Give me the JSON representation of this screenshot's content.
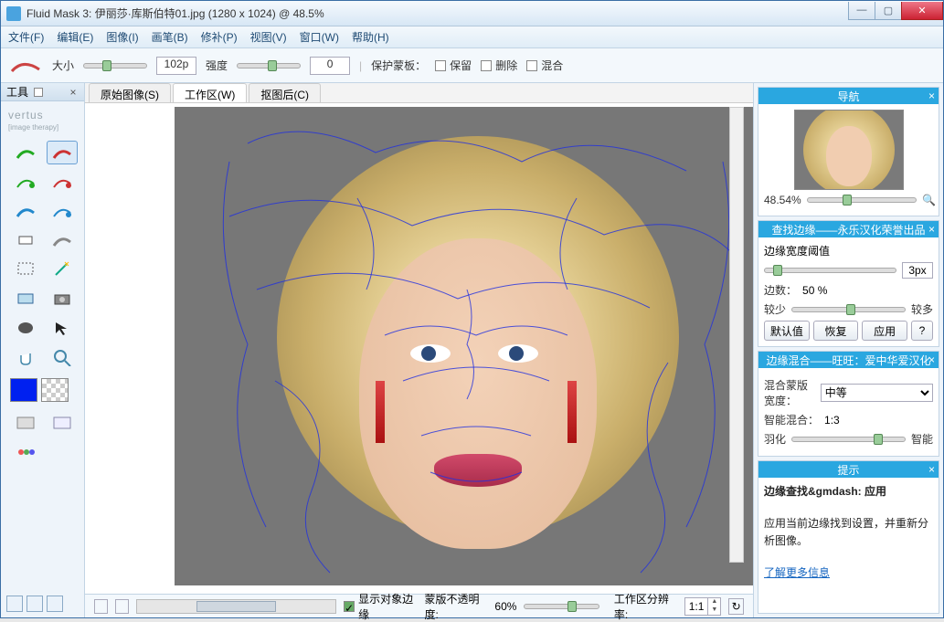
{
  "title": "Fluid Mask 3: 伊丽莎·库斯伯特01.jpg (1280 x 1024) @ 48.5%",
  "menu": [
    "文件(F)",
    "编辑(E)",
    "图像(I)",
    "画笔(B)",
    "修补(P)",
    "视图(V)",
    "窗口(W)",
    "帮助(H)"
  ],
  "opt": {
    "size_label": "大小",
    "size_value": "102p",
    "strength_label": "强度",
    "strength_value": "0",
    "protect_label": "保护蒙板：",
    "chk_keep": "保留",
    "chk_delete": "删除",
    "chk_blend": "混合"
  },
  "tools_header": "工具",
  "logo": "vertus",
  "logo_sub": "[image therapy]",
  "tabs": {
    "orig": "原始图像(S)",
    "work": "工作区(W)",
    "cut": "抠图后(C)"
  },
  "footer": {
    "show_edges": "显示对象边缘",
    "mask_opacity_label": "蒙版不透明度:",
    "mask_opacity_value": "60%",
    "res_label": "工作区分辨率:",
    "res_value": "1:1"
  },
  "nav": {
    "title": "导航",
    "zoom": "48.54%"
  },
  "edge_find": {
    "title": "查找边缘——永乐汉化荣誉出品",
    "threshold_label": "边缘宽度阈值",
    "threshold_value": "3px",
    "count_label": "边数：",
    "count_value": "50 %",
    "less": "较少",
    "more": "较多",
    "btn_default": "默认值",
    "btn_reset": "恢复",
    "btn_apply": "应用"
  },
  "edge_blend": {
    "title": "边缘混合——旺旺：爱中华爱汉化",
    "width_label": "混合蒙版宽度：",
    "width_value": "中等",
    "smart_label": "智能混合：",
    "smart_value": "1:3",
    "feather_label": "羽化",
    "smart_end": "智能"
  },
  "tip": {
    "title": "提示",
    "heading": "边缘查找&gmdash: 应用",
    "body": "应用当前边缘找到设置，并重新分析图像。",
    "link": "了解更多信息"
  }
}
